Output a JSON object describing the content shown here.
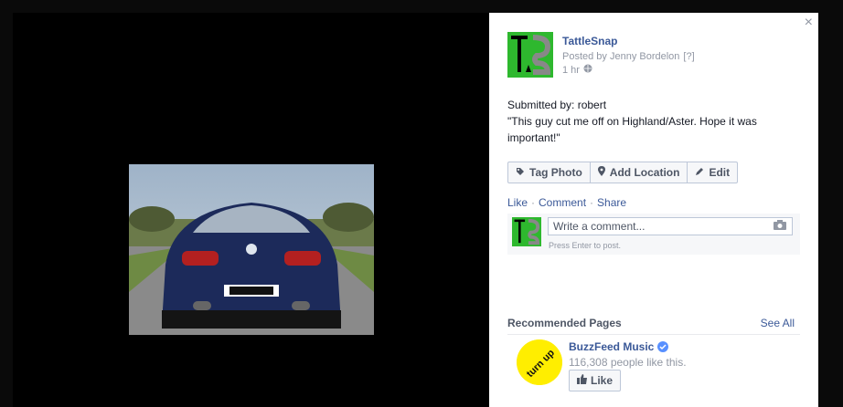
{
  "photo": {
    "alt": "Dark blue car rear view on road"
  },
  "post": {
    "page_name": "TattleSnap",
    "posted_by": "Posted by Jenny Bordelon",
    "help": "[?]",
    "time": "1 hr",
    "body": "Submitted by: robert\n\"This guy cut me off on Highland/Aster. Hope it was important!\""
  },
  "buttons": {
    "tag_photo": "Tag Photo",
    "add_location": "Add Location",
    "edit": "Edit"
  },
  "actions": {
    "like": "Like",
    "comment": "Comment",
    "share": "Share"
  },
  "comment": {
    "placeholder": "Write a comment...",
    "hint": "Press Enter to post."
  },
  "recommended": {
    "title": "Recommended Pages",
    "see_all": "See All",
    "page": {
      "name": "BuzzFeed Music",
      "likes": "116,308 people like this.",
      "like_label": "Like",
      "logo_text": "turn up"
    }
  },
  "close_label": "×",
  "colors": {
    "link": "#3b5998",
    "logo_green": "#2eb82e",
    "buzz_yellow": "#ffee00"
  },
  "icons": [
    "close-icon",
    "globe-icon",
    "tag-icon",
    "location-pin-icon",
    "pencil-icon",
    "camera-icon",
    "verified-icon",
    "thumbs-up-icon"
  ]
}
